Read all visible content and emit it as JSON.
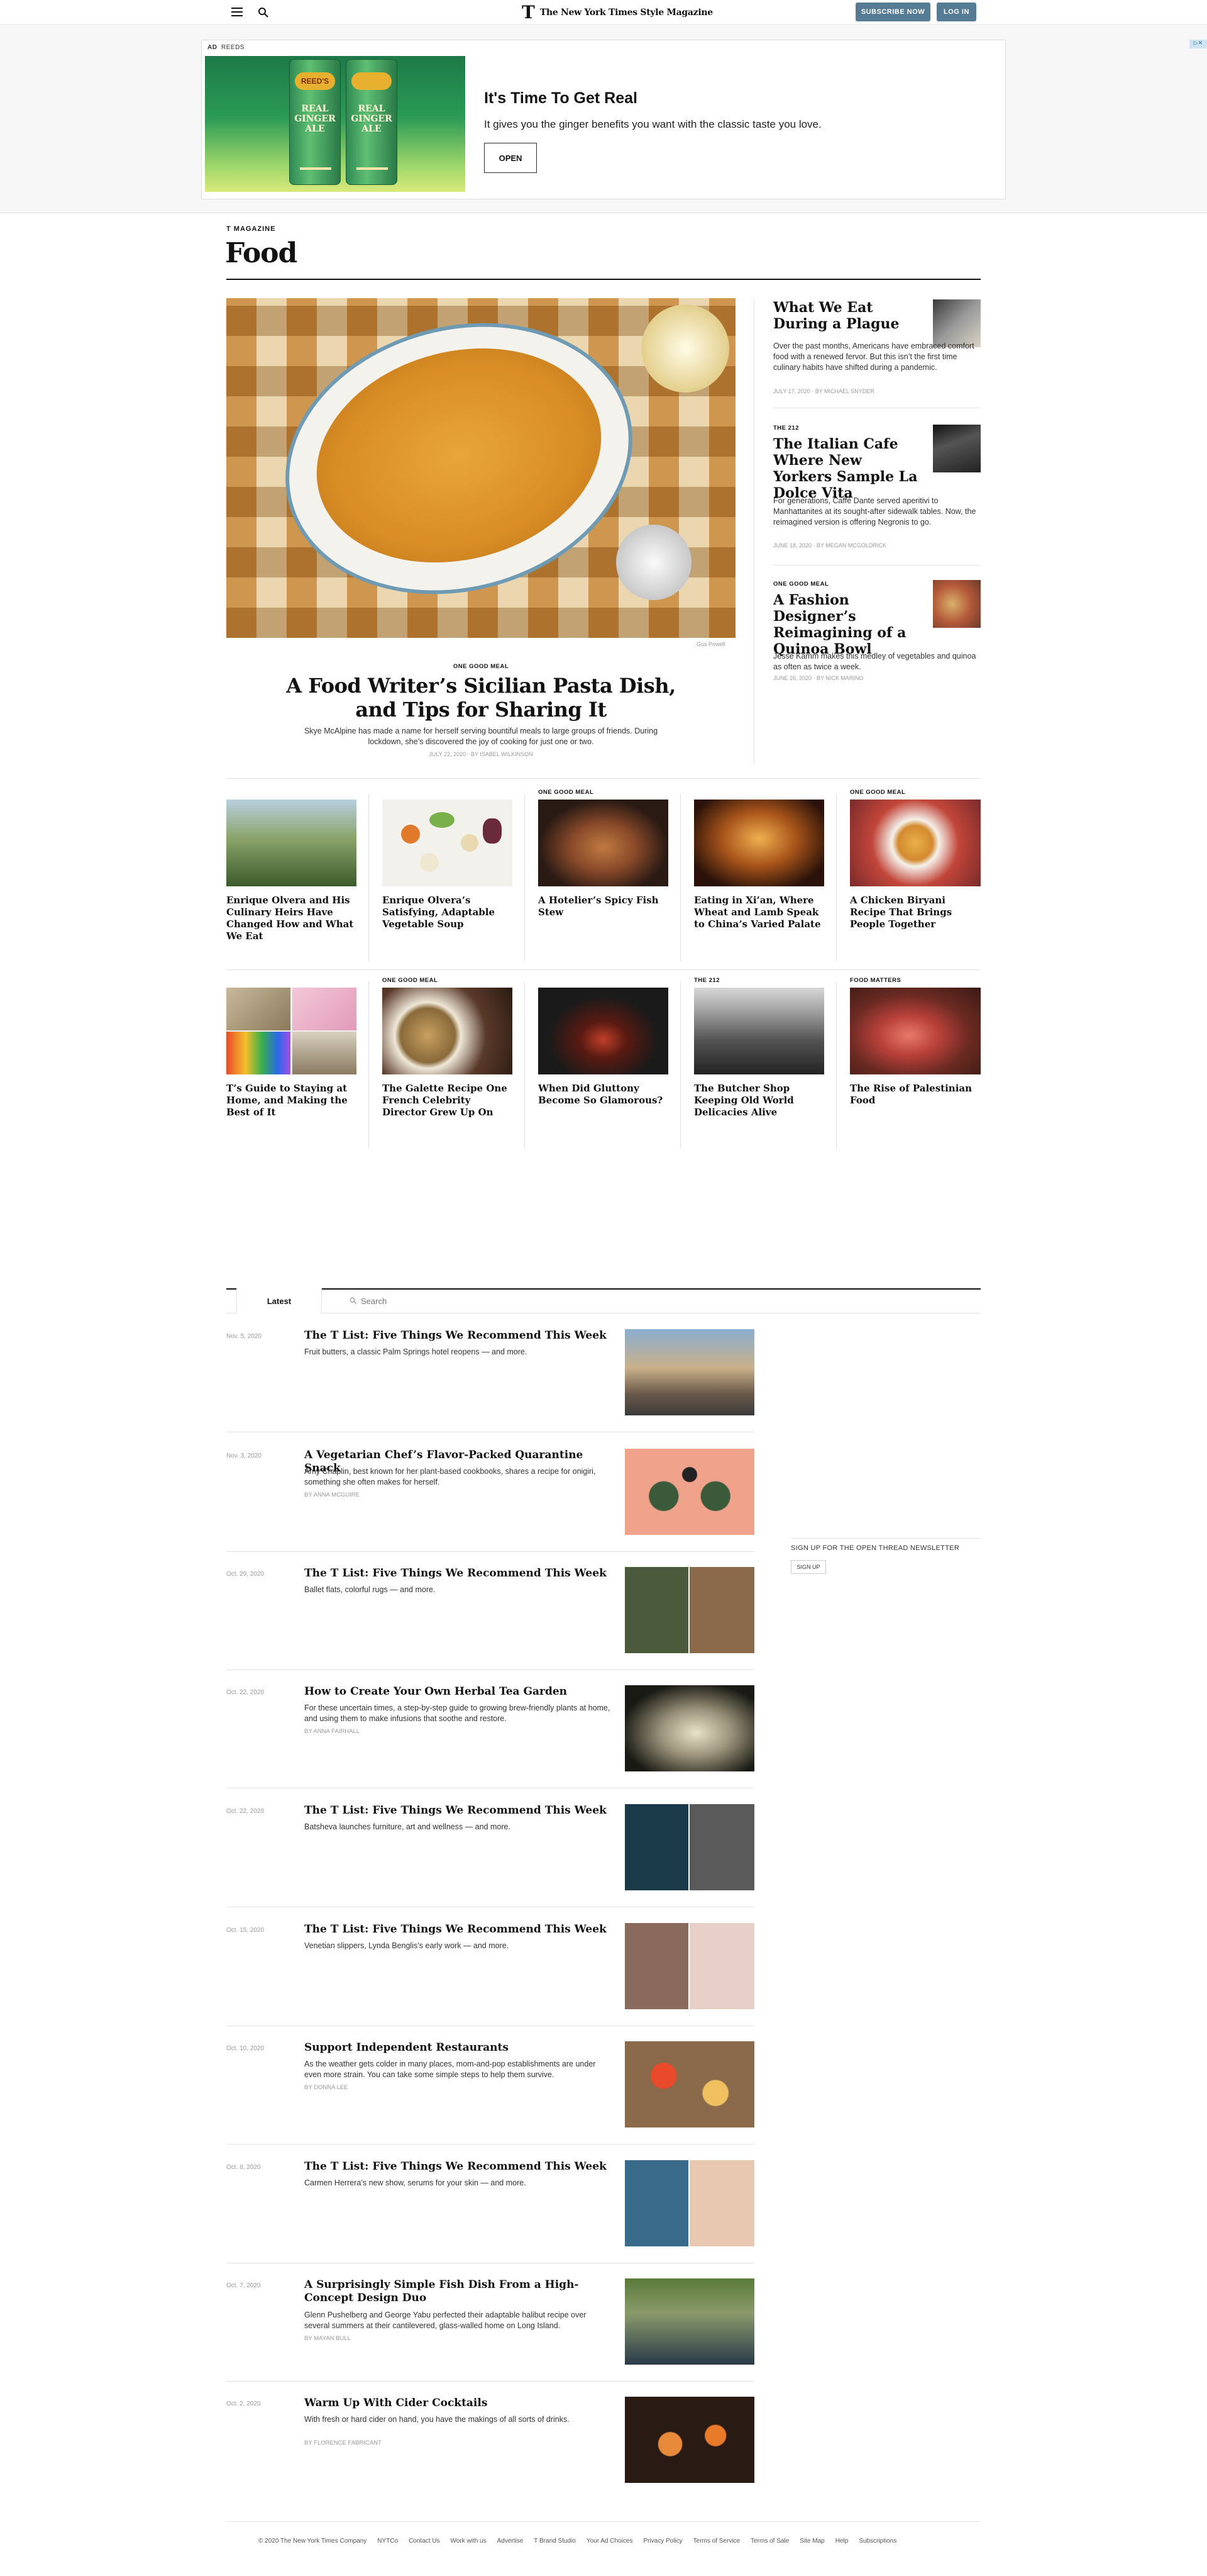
{
  "header": {
    "brand": "The New York Times Style Magazine",
    "t_logo": "T",
    "subscribe": "SUBSCRIBE NOW",
    "login": "LOG IN"
  },
  "ad": {
    "label": "AD",
    "sponsor": "REEDS",
    "can_brand": "REED'S",
    "can_text": "REAL GINGER ALE",
    "can_text_2": "REAL GINGER ALE",
    "title": "It's Time To Get Real",
    "text": "It gives you the ginger benefits you want with the classic taste you love.",
    "cta": "OPEN"
  },
  "section": {
    "kicker": "T MAGAZINE",
    "title": "Food"
  },
  "hero": {
    "credit": "Gus Powell",
    "kicker": "ONE GOOD MEAL",
    "title": "A Food Writer’s Sicilian Pasta Dish, and Tips for Sharing It",
    "summary": "Skye McAlpine has made a name for herself serving bountiful meals to large groups of friends. During lockdown, she’s discovered the joy of cooking for just one or two.",
    "byline": "July 22, 2020 · By ISABEL WILKINSON"
  },
  "side_stories": [
    {
      "kicker": "",
      "title": "What We Eat During a Plague",
      "summary": "Over the past months, Americans have embraced comfort food with a renewed fervor. But this isn’t the first time culinary habits have shifted during a pandemic.",
      "byline": "July 17, 2020 · By MICHAEL SNYDER"
    },
    {
      "kicker": "THE 212",
      "title": "The Italian Cafe Where New Yorkers Sample La Dolce Vita",
      "summary": "For generations, Caffè Dante served aperitivi to Manhattanites at its sought-after sidewalk tables. Now, the reimagined version is offering Negronis to go.",
      "byline": "June 18, 2020 · By MEGAN McGOLDRICK"
    },
    {
      "kicker": "ONE GOOD MEAL",
      "title": "A Fashion Designer’s Reimagining of a Quinoa Bowl",
      "summary": "Jesse Kamm makes this medley of vegetables and quinoa as often as twice a week.",
      "byline": "June 26, 2020 · By NICK MARINO"
    }
  ],
  "grid_row_1": [
    {
      "kicker": "",
      "title": "Enrique Olvera and His Culinary Heirs Have Changed How and What We Eat"
    },
    {
      "kicker": "",
      "title": "Enrique Olvera’s Satisfying, Adaptable Vegetable Soup"
    },
    {
      "kicker": "ONE GOOD MEAL",
      "title": "A Hotelier’s Spicy Fish Stew"
    },
    {
      "kicker": "",
      "title": "Eating in Xi’an, Where Wheat and Lamb Speak to China’s Varied Palate"
    },
    {
      "kicker": "ONE GOOD MEAL",
      "title": "A Chicken Biryani Recipe That Brings People Together"
    }
  ],
  "grid_row_2": [
    {
      "kicker": "",
      "title": "T’s Guide to Staying at Home, and Making the Best of It"
    },
    {
      "kicker": "ONE GOOD MEAL",
      "title": "The Galette Recipe One French Celebrity Director Grew Up On"
    },
    {
      "kicker": "",
      "title": "When Did Gluttony Become So Glamorous?"
    },
    {
      "kicker": "THE 212",
      "title": "The Butcher Shop Keeping Old World Delicacies Alive"
    },
    {
      "kicker": "FOOD MATTERS",
      "title": "The Rise of Palestinian Food"
    }
  ],
  "latest": {
    "tab": "Latest",
    "search_placeholder": "Search",
    "items": [
      {
        "date": "Nov. 5, 2020",
        "title": "The T List: Five Things We Recommend This Week",
        "summary": "Fruit butters, a classic Palm Springs hotel reopens — and more.",
        "byline": ""
      },
      {
        "date": "Nov. 3, 2020",
        "title": "A Vegetarian Chef’s Flavor-Packed Quarantine Snack",
        "summary": "Amy Chaplin, best known for her plant-based cookbooks, shares a recipe for onigiri, something she often makes for herself.",
        "byline": "By ANNA McGUIRE"
      },
      {
        "date": "Oct. 29, 2020",
        "title": "The T List: Five Things We Recommend This Week",
        "summary": "Ballet flats, colorful rugs — and more.",
        "byline": ""
      },
      {
        "date": "Oct. 22, 2020",
        "title": "How to Create Your Own Herbal Tea Garden",
        "summary": "For these uncertain times, a step-by-step guide to growing brew-friendly plants at home, and using them to make infusions that soothe and restore.",
        "byline": "By ANNA FAIRHALL"
      },
      {
        "date": "Oct. 22, 2020",
        "title": "The T List: Five Things We Recommend This Week",
        "summary": "Batsheva launches furniture, art and wellness — and more.",
        "byline": ""
      },
      {
        "date": "Oct. 15, 2020",
        "title": "The T List: Five Things We Recommend This Week",
        "summary": "Venetian slippers, Lynda Benglis’s early work — and more.",
        "byline": ""
      },
      {
        "date": "Oct. 10, 2020",
        "title": "Support Independent Restaurants",
        "summary": "As the weather gets colder in many places, mom-and-pop establishments are under even more strain. You can take some simple steps to help them survive.",
        "byline": "By DONNA LEE"
      },
      {
        "date": "Oct. 8, 2020",
        "title": "The T List: Five Things We Recommend This Week",
        "summary": "Carmen Herrera’s new show, serums for your skin — and more.",
        "byline": ""
      },
      {
        "date": "Oct. 7, 2020",
        "title": "A Surprisingly Simple Fish Dish From a High-Concept Design Duo",
        "summary": "Glenn Pushelberg and George Yabu perfected their adaptable halibut recipe over several summers at their cantilevered, glass-walled home on Long Island.",
        "byline": "By MAYAN BULL"
      },
      {
        "date": "Oct. 2, 2020",
        "title": "Warm Up With Cider Cocktails",
        "summary": "With fresh or hard cider on hand, you have the makings of all sorts of drinks.",
        "byline": "By FLORENCE FABRICANT"
      }
    ]
  },
  "newsletter": {
    "title": "SIGN UP FOR THE OPEN THREAD NEWSLETTER",
    "button": "SIGN UP"
  },
  "footer": {
    "links": [
      "© 2020 The New York Times Company",
      "NYTCo",
      "Contact Us",
      "Work with us",
      "Advertise",
      "T Brand Studio",
      "Your Ad Choices",
      "Privacy Policy",
      "Terms of Service",
      "Terms of Sale",
      "Site Map",
      "Help",
      "Subscriptions"
    ]
  }
}
